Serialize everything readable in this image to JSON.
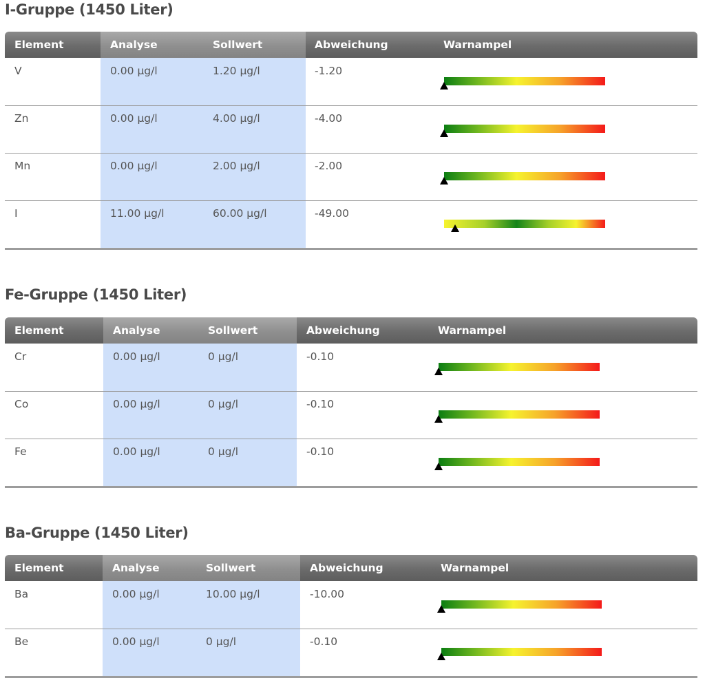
{
  "groups": [
    {
      "title": "I-Gruppe (1450 Liter)",
      "headers": {
        "element": "Element",
        "analyse": "Analyse",
        "sollwert": "Sollwert",
        "abweichung": "Abweichung",
        "warnampel": "Warnampel"
      },
      "rows": [
        {
          "element": "V",
          "analyse": "0.00 µg/l",
          "sollwert": "1.20 µg/l",
          "abweichung": "-1.20",
          "gauge_scale": "low",
          "marker_fraction": 0.0
        },
        {
          "element": "Zn",
          "analyse": "0.00 µg/l",
          "sollwert": "4.00 µg/l",
          "abweichung": "-4.00",
          "gauge_scale": "low",
          "marker_fraction": 0.0
        },
        {
          "element": "Mn",
          "analyse": "0.00 µg/l",
          "sollwert": "2.00 µg/l",
          "abweichung": "-2.00",
          "gauge_scale": "low",
          "marker_fraction": 0.0
        },
        {
          "element": "I",
          "analyse": "11.00 µg/l",
          "sollwert": "60.00 µg/l",
          "abweichung": "-49.00",
          "gauge_scale": "centered",
          "marker_fraction": 0.07
        }
      ]
    },
    {
      "title": "Fe-Gruppe (1450 Liter)",
      "headers": {
        "element": "Element",
        "analyse": "Analyse",
        "sollwert": "Sollwert",
        "abweichung": "Abweichung",
        "warnampel": "Warnampel"
      },
      "rows": [
        {
          "element": "Cr",
          "analyse": "0.00 µg/l",
          "sollwert": "0 µg/l",
          "abweichung": "-0.10",
          "gauge_scale": "low",
          "marker_fraction": 0.0
        },
        {
          "element": "Co",
          "analyse": "0.00 µg/l",
          "sollwert": "0 µg/l",
          "abweichung": "-0.10",
          "gauge_scale": "low",
          "marker_fraction": 0.0
        },
        {
          "element": "Fe",
          "analyse": "0.00 µg/l",
          "sollwert": "0 µg/l",
          "abweichung": "-0.10",
          "gauge_scale": "low",
          "marker_fraction": 0.0
        }
      ]
    },
    {
      "title": "Ba-Gruppe (1450 Liter)",
      "headers": {
        "element": "Element",
        "analyse": "Analyse",
        "sollwert": "Sollwert",
        "abweichung": "Abweichung",
        "warnampel": "Warnampel"
      },
      "rows": [
        {
          "element": "Ba",
          "analyse": "0.00 µg/l",
          "sollwert": "10.00 µg/l",
          "abweichung": "-10.00",
          "gauge_scale": "low",
          "marker_fraction": 0.0
        },
        {
          "element": "Be",
          "analyse": "0.00 µg/l",
          "sollwert": "0 µg/l",
          "abweichung": "-0.10",
          "gauge_scale": "low",
          "marker_fraction": 0.0
        }
      ]
    }
  ],
  "colors": {
    "header_dark": "#666666",
    "header_highlight": "#969696",
    "column_highlight": "#cfe0fa",
    "gauge_green": "#0b7d12",
    "gauge_yellow": "#f6f32e",
    "gauge_red": "#f41a1a",
    "marker": "#000000"
  }
}
